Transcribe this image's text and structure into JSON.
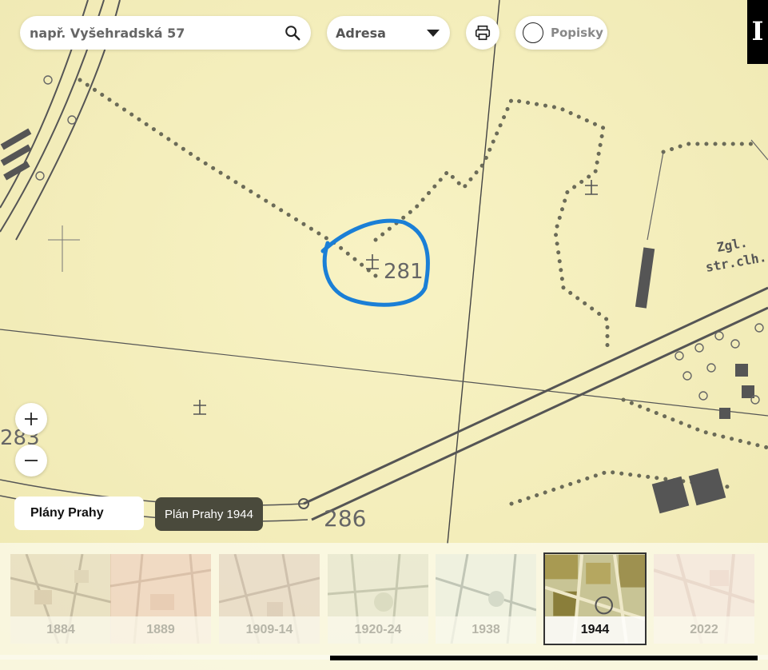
{
  "search": {
    "placeholder": "např. Vyšehradská 57",
    "icon": "search-icon"
  },
  "address_select": {
    "selected": "Adresa"
  },
  "print": {
    "icon": "printer-icon"
  },
  "labels_toggle": {
    "label": "Popisky",
    "checked": false
  },
  "info_button": {
    "label": "I"
  },
  "map": {
    "labels": [
      "281",
      "283",
      "286",
      "Zgl.",
      "str.clh."
    ],
    "marker_color": "#1a7fd6",
    "paper_color": "#f6f1bf"
  },
  "zoom": {
    "in_icon": "plus-icon",
    "out_icon": "minus-icon"
  },
  "plans_button": {
    "label": "Plány Prahy"
  },
  "current_plan": {
    "label": "Plán Prahy 1944"
  },
  "timeline": {
    "items": [
      {
        "year": "1884",
        "active": false
      },
      {
        "year": "1889",
        "active": false
      },
      {
        "year": "1909-14",
        "active": false
      },
      {
        "year": "1920-24",
        "active": false
      },
      {
        "year": "1938",
        "active": false
      },
      {
        "year": "1944",
        "active": true
      },
      {
        "year": "2022",
        "active": false
      }
    ]
  }
}
